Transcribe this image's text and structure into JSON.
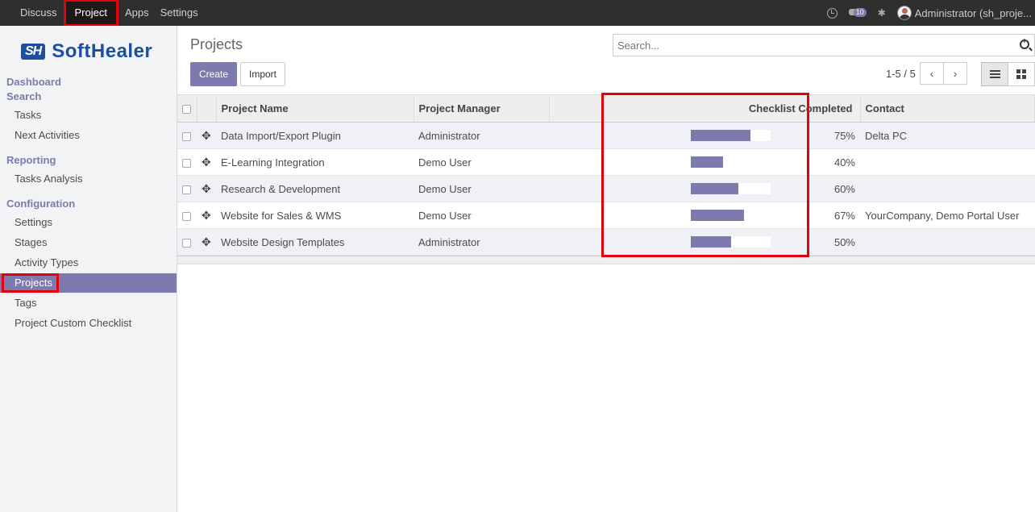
{
  "topnav": {
    "items": [
      "Discuss",
      "Project",
      "Apps",
      "Settings"
    ],
    "active": "Project",
    "chat_count": "10",
    "user": "Administrator (sh_proje..."
  },
  "sidebar": {
    "logo_mark": "SH",
    "logo_name": "SoftHealer",
    "sections": {
      "dashboard": "Dashboard",
      "search": "Search",
      "reporting": "Reporting",
      "configuration": "Configuration"
    },
    "items": {
      "tasks": "Tasks",
      "next_activities": "Next Activities",
      "tasks_analysis": "Tasks Analysis",
      "settings": "Settings",
      "stages": "Stages",
      "activity_types": "Activity Types",
      "projects": "Projects",
      "tags": "Tags",
      "custom_checklist": "Project Custom Checklist"
    }
  },
  "main": {
    "title": "Projects",
    "search_placeholder": "Search...",
    "create": "Create",
    "import": "Import",
    "pager": "1-5 / 5"
  },
  "table": {
    "headers": {
      "name": "Project Name",
      "manager": "Project Manager",
      "checklist": "Checklist Completed",
      "contact": "Contact"
    },
    "rows": [
      {
        "name": "Data Import/Export Plugin",
        "manager": "Administrator",
        "progress": 75,
        "pct": "75%",
        "contact": "Delta PC"
      },
      {
        "name": "E-Learning Integration",
        "manager": "Demo User",
        "progress": 40,
        "pct": "40%",
        "contact": ""
      },
      {
        "name": "Research & Development",
        "manager": "Demo User",
        "progress": 60,
        "pct": "60%",
        "contact": ""
      },
      {
        "name": "Website for Sales & WMS",
        "manager": "Demo User",
        "progress": 67,
        "pct": "67%",
        "contact": "YourCompany, Demo Portal User"
      },
      {
        "name": "Website Design Templates",
        "manager": "Administrator",
        "progress": 50,
        "pct": "50%",
        "contact": ""
      }
    ]
  },
  "colors": {
    "accent": "#7c7bad",
    "highlight": "#e3000f",
    "topbar": "#2f2f2f"
  }
}
